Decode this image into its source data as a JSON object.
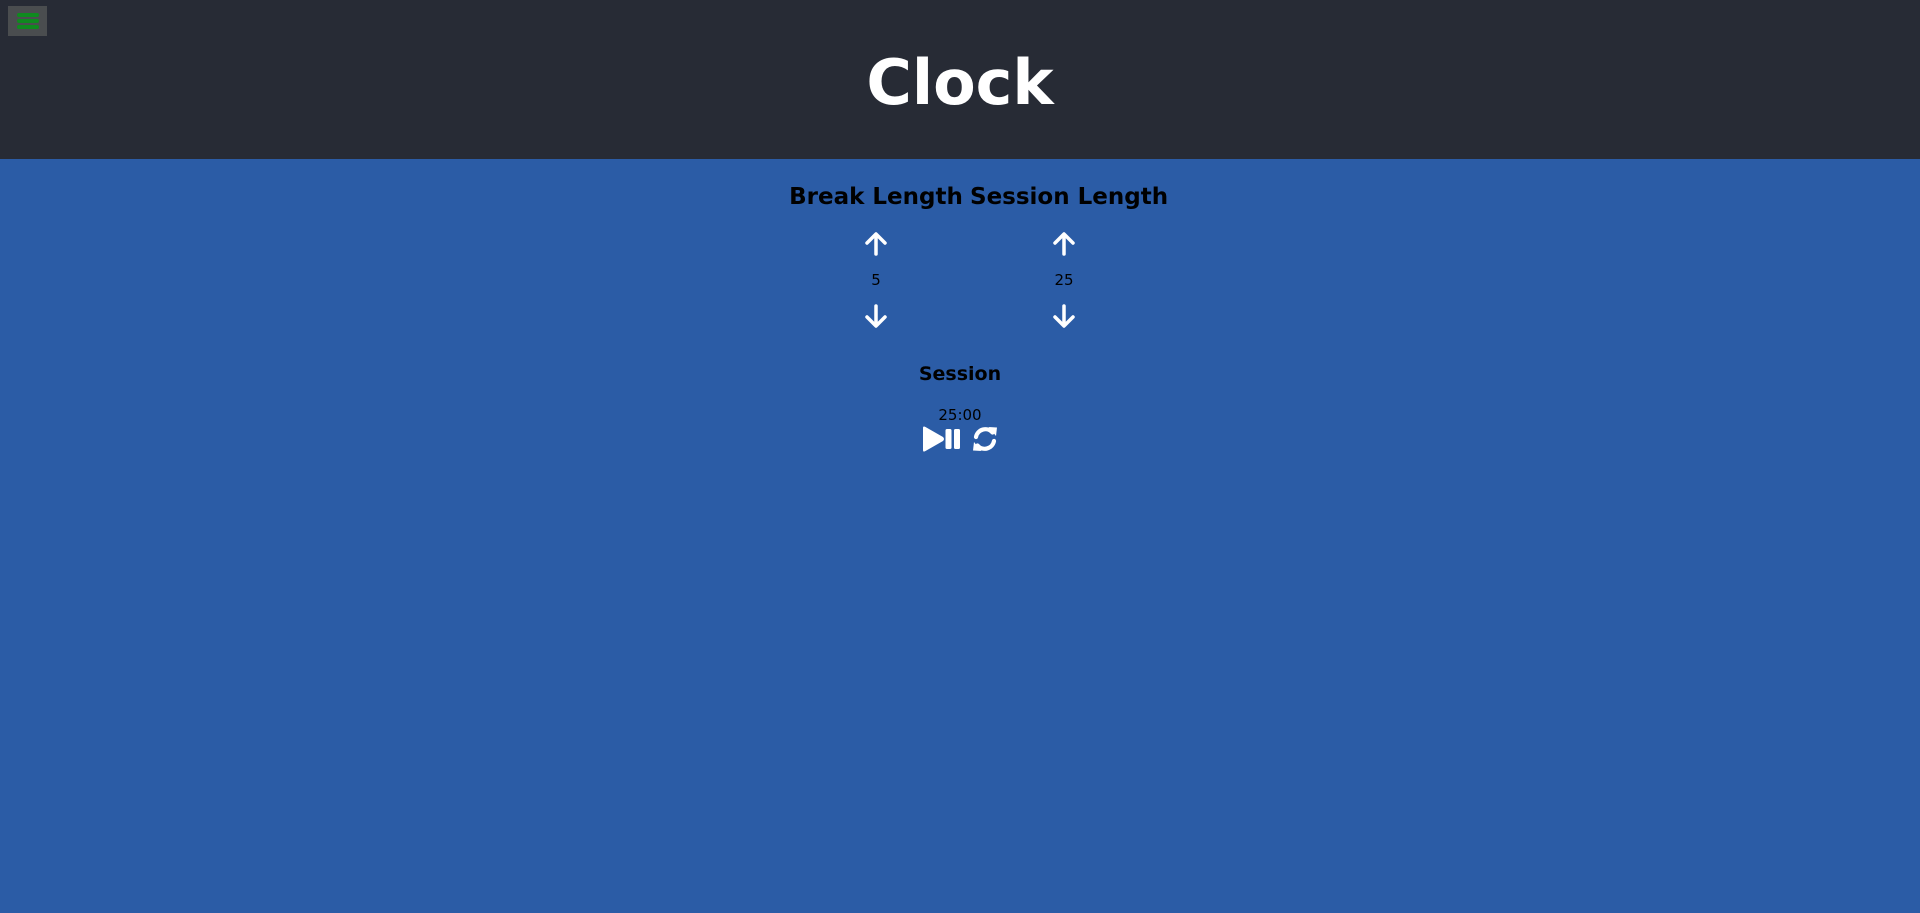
{
  "header": {
    "title": "Clock",
    "menu_icon": "hamburger-menu-icon",
    "menu_icon_color": "#0f8a1f"
  },
  "break": {
    "label": "Break Length",
    "value": "5",
    "increment_icon": "arrow-up-icon",
    "decrement_icon": "arrow-down-icon"
  },
  "session": {
    "label": "Session Length",
    "value": "25",
    "increment_icon": "arrow-up-icon",
    "decrement_icon": "arrow-down-icon"
  },
  "timer": {
    "label": "Session",
    "time": "25:00",
    "play_pause_icon": "play-pause-icon",
    "reset_icon": "refresh-icon"
  },
  "colors": {
    "header_bg": "#272b35",
    "page_bg": "#2b5ca6",
    "title": "#ffffff",
    "icons": "#ffffff"
  }
}
